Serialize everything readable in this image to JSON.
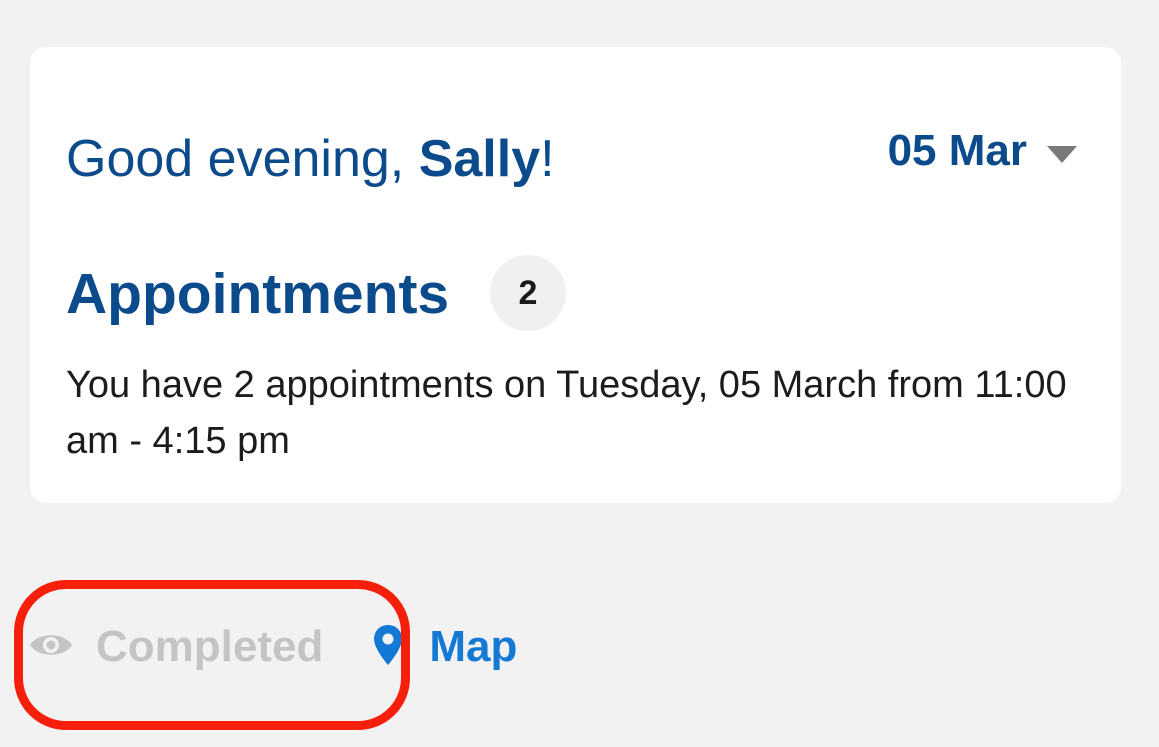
{
  "greeting": {
    "prefix": "Good evening, ",
    "name": "Sally",
    "suffix": "!"
  },
  "date_picker": {
    "value": "05 Mar",
    "icon": "caret-down-icon"
  },
  "appointments": {
    "title": "Appointments",
    "count": "2",
    "description": "You have 2 appointments on Tuesday, 05 March from 11:00 am - 4:15 pm"
  },
  "filters": {
    "completed": {
      "label": "Completed",
      "icon": "eye-icon",
      "color": "#c4c4c4"
    },
    "map": {
      "label": "Map",
      "icon": "map-pin-icon",
      "color": "#1479d4"
    }
  },
  "colors": {
    "brand": "#0b4a8b",
    "highlight": "#f51f0b",
    "background": "#f2f2f2"
  }
}
